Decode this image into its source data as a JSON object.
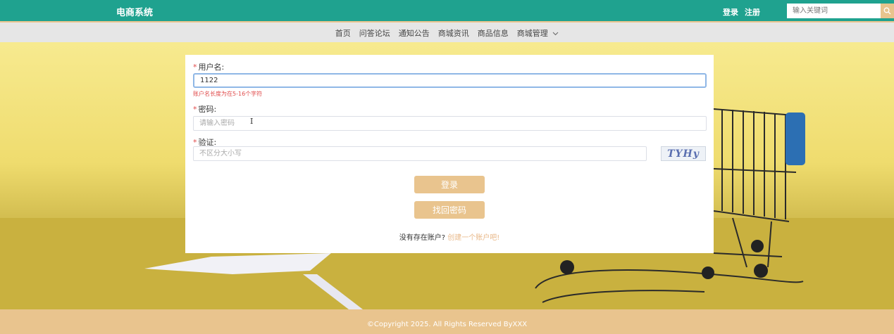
{
  "header": {
    "brand": "电商系统",
    "login_label": "登录",
    "register_label": "注册",
    "search": {
      "placeholder": "输入关键词",
      "icon": "search-icon"
    }
  },
  "nav": {
    "items": [
      {
        "label": "首页"
      },
      {
        "label": "问答论坛"
      },
      {
        "label": "通知公告"
      },
      {
        "label": "商城资讯"
      },
      {
        "label": "商品信息"
      },
      {
        "label": "商城管理"
      }
    ],
    "dropdown_icon": "chevron-down-icon"
  },
  "form": {
    "username": {
      "label": "用户名:",
      "value": "1122",
      "error": "账户名长度为在5-16个字符"
    },
    "password": {
      "label": "密码:",
      "placeholder": "请输入密码"
    },
    "captcha": {
      "label": "验证:",
      "placeholder": "不区分大小写",
      "code": "TYHy"
    },
    "required_mark": "*",
    "login_button": "登录",
    "recover_button": "找回密码",
    "no_account_text": "没有存在账户?",
    "create_account_link": "创建一个账户吧!"
  },
  "footer": {
    "copyright": "©Copyright 2025. All Rights Reserved ByXXX"
  },
  "colors": {
    "header": "#1fa28f",
    "accent": "#e9c48e",
    "error": "#e04b4b",
    "input_focus": "#8fb7e6"
  }
}
